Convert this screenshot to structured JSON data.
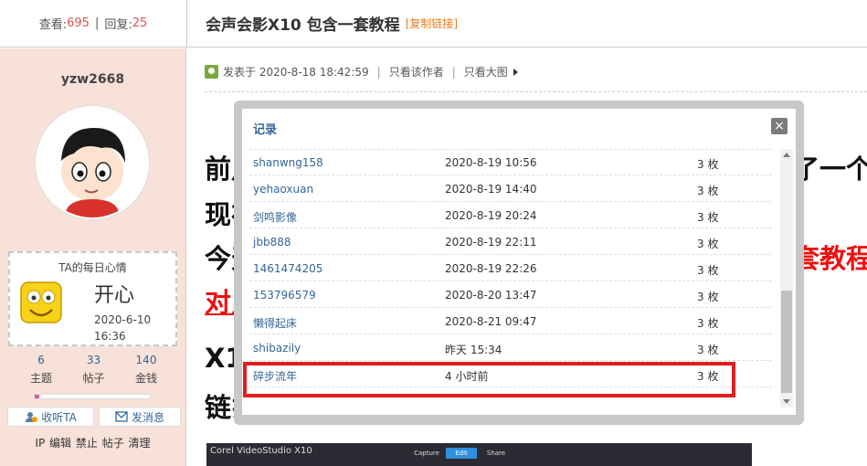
{
  "header": {
    "views_label": "查看:",
    "views": "695",
    "replies_label": "回复:",
    "replies": "25",
    "thread_title": "会声会影X10 包含一套教程",
    "copy_link": "[复制链接]"
  },
  "author": {
    "username": "yzw2668",
    "mood_title": "TA的每日心情",
    "mood": "开心",
    "mood_date": "2020-6-10",
    "mood_time": "16:36",
    "stats": [
      {
        "value": "6",
        "label": "主题"
      },
      {
        "value": "33",
        "label": "帖子"
      },
      {
        "value": "140",
        "label": "金钱"
      }
    ],
    "progress_fraction": 0.04,
    "follow_label": "收听TA",
    "message_label": "发消息",
    "admin_links": "IP 编辑 禁止 帖子 清理"
  },
  "post": {
    "posted_at": "发表于 2020-8-18 18:42:59",
    "only_author": "只看该作者",
    "only_images": "只看大图",
    "line1_left": "前馬",
    "line1_right": "了一个",
    "line2_left": "现在",
    "line3_left": "今天",
    "line3_right": "套教程",
    "line4_left": "对几",
    "line5_left": "X1",
    "line6_left": "链扌"
  },
  "video_preview": {
    "logo": "Corel VideoStudio X10",
    "tabs": [
      "Capture",
      "Edit",
      "Share"
    ]
  },
  "modal": {
    "title": "记录",
    "close": "×",
    "rows": [
      {
        "user": "shanwng158",
        "time": "2020-8-19 10:56",
        "count": "3 枚"
      },
      {
        "user": "yehaoxuan",
        "time": "2020-8-19 14:40",
        "count": "3 枚"
      },
      {
        "user": "剑鸣影像",
        "time": "2020-8-19 20:24",
        "count": "3 枚"
      },
      {
        "user": "jbb888",
        "time": "2020-8-19 22:11",
        "count": "3 枚"
      },
      {
        "user": "1461474205",
        "time": "2020-8-19 22:26",
        "count": "3 枚"
      },
      {
        "user": "153796579",
        "time": "2020-8-20 13:47",
        "count": "3 枚"
      },
      {
        "user": "懒得起床",
        "time": "2020-8-21 09:47",
        "count": "3 枚"
      },
      {
        "user": "shibazily",
        "time": "昨天 15:34",
        "count": "3 枚"
      },
      {
        "user": "碎步流年",
        "time": "4 小时前",
        "count": "3 枚"
      }
    ]
  },
  "colors": {
    "link": "#336699",
    "sidebar_bg": "#f7e1d8",
    "highlight": "#e02020",
    "accent_red": "#e11111"
  }
}
